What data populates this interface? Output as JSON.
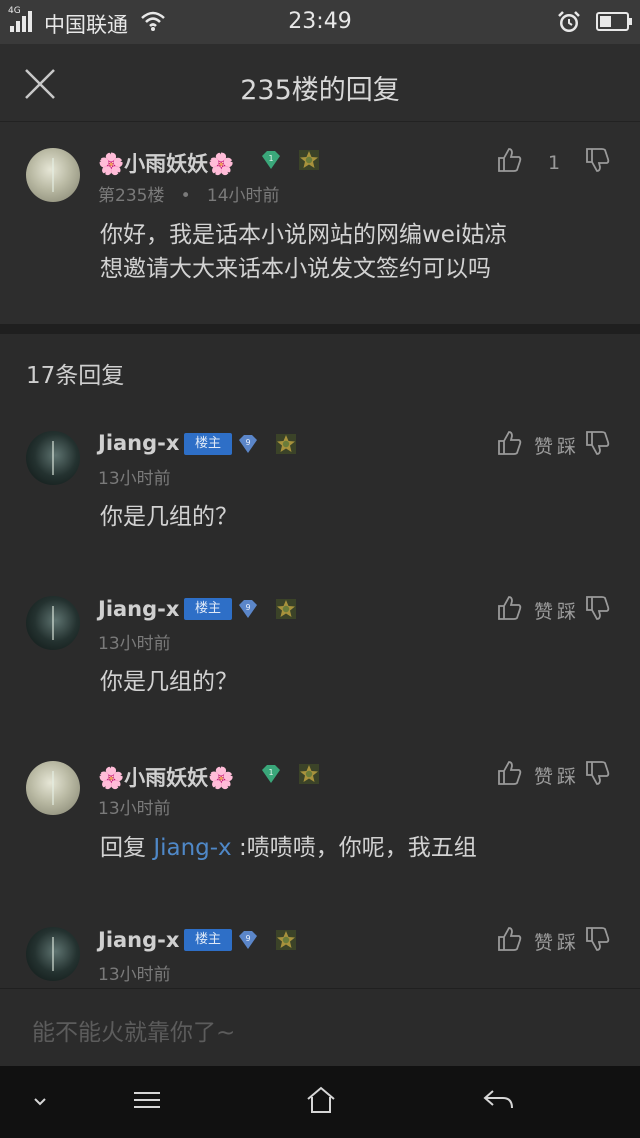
{
  "status_bar": {
    "network": "4G",
    "carrier": "中国联通",
    "time": "23:49",
    "battery_level": 0.45,
    "icons": [
      "signal-icon",
      "wifi-icon",
      "alarm-icon",
      "battery-icon"
    ]
  },
  "header": {
    "title": "235楼的回复",
    "close_icon": "close-icon"
  },
  "post": {
    "author": "小雨妖妖",
    "deco": "🌸",
    "level": "1",
    "floor": "第235楼",
    "dot": "•",
    "time": "14小时前",
    "line1": "你好，我是话本小说网站的网编wei姑凉",
    "line2": "想邀请大大来话本小说发文签约可以吗",
    "like_count": "1"
  },
  "replies_count_label": "17条回复",
  "replies": [
    {
      "author": "Jiang-x",
      "badge": "楼主",
      "level": "9",
      "time": "13小时前",
      "text": "你是几组的？",
      "like_label": "赞",
      "dislike_label": "踩"
    },
    {
      "author": "Jiang-x",
      "badge": "楼主",
      "level": "9",
      "time": "13小时前",
      "text": "你是几组的？",
      "like_label": "赞",
      "dislike_label": "踩"
    },
    {
      "author": "小雨妖妖",
      "deco": "🌸",
      "level": "1",
      "time": "13小时前",
      "reply_prefix": "回复",
      "reply_to": "Jiang-x",
      "text": ":啧啧啧，你呢，我五组",
      "like_label": "赞",
      "dislike_label": "踩"
    },
    {
      "author": "Jiang-x",
      "badge": "楼主",
      "level": "9",
      "time": "13小时前",
      "like_label": "赞",
      "dislike_label": "踩"
    }
  ],
  "input": {
    "placeholder": "能不能火就靠你了~"
  },
  "nav_bar": {
    "icons": [
      "chevron-down-icon",
      "menu-icon",
      "home-icon",
      "back-icon"
    ]
  },
  "colors": {
    "background": "#2b2b2b",
    "host_badge": "#2e6fc7",
    "link": "#4f88c8",
    "green_level": "#3aa77a",
    "blue_level": "#5b86c9"
  }
}
